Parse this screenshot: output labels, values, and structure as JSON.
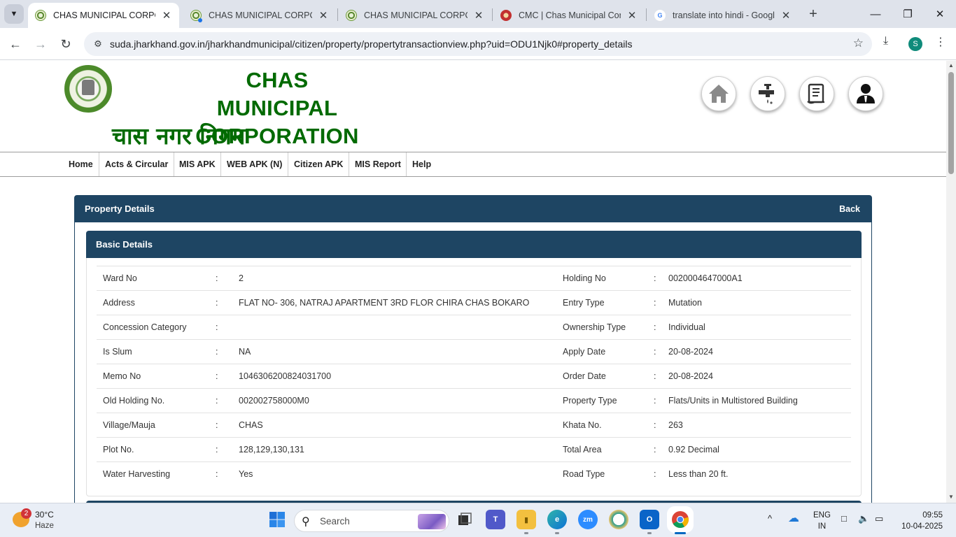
{
  "browser": {
    "tabs": [
      {
        "title": "CHAS MUNICIPAL CORPORA",
        "active": true
      },
      {
        "title": "CHAS MUNICIPAL CORPORA",
        "active": false
      },
      {
        "title": "CHAS MUNICIPAL CORPORA",
        "active": false
      },
      {
        "title": "CMC | Chas Municipal Corpo",
        "active": false
      },
      {
        "title": "translate into hindi - Google",
        "active": false
      }
    ],
    "url_host": "suda.jharkhand.gov.in",
    "url_path": "/jharkhandmunicipal/citizen/property/propertytransactionview.php?uid=ODU1Njk0#property_details",
    "profile_initial": "S"
  },
  "header": {
    "title": "CHAS MUNICIPAL CORPORATION",
    "title_hindi": "चास नगर निगम",
    "icons": [
      "home-icon",
      "water-tap-icon",
      "certificate-icon",
      "user-icon"
    ]
  },
  "nav": {
    "items": [
      "Home",
      "Acts & Circular",
      "MIS APK",
      "WEB APK (N)",
      "Citizen APK",
      "MIS Report",
      "Help"
    ]
  },
  "panel": {
    "title": "Property Details",
    "back_label": "Back",
    "section_title": "Basic Details",
    "rows": [
      {
        "label": "Ward No",
        "value": "2",
        "label2": "Holding No",
        "value2": "0020004647000A1"
      },
      {
        "label": "Address",
        "value": "FLAT NO- 306, NATRAJ APARTMENT 3RD FLOR CHIRA CHAS BOKARO",
        "label2": "Entry Type",
        "value2": "Mutation"
      },
      {
        "label": "Concession Category",
        "value": "",
        "label2": "Ownership Type",
        "value2": "Individual"
      },
      {
        "label": "Is Slum",
        "value": "NA",
        "label2": "Apply Date",
        "value2": "20-08-2024"
      },
      {
        "label": "Memo No",
        "value": "1046306200824031700",
        "label2": "Order Date",
        "value2": "20-08-2024"
      },
      {
        "label": "Old Holding No.",
        "value": "002002758000M0",
        "label2": "Property Type",
        "value2": "Flats/Units in Multistored Building"
      },
      {
        "label": "Village/Mauja",
        "value": "CHAS",
        "label2": "Khata No.",
        "value2": "263"
      },
      {
        "label": "Plot No.",
        "value": "128,129,130,131",
        "label2": "Total Area",
        "value2": "0.92 Decimal"
      },
      {
        "label": "Water Harvesting",
        "value": "Yes",
        "label2": "Road Type",
        "value2": "Less than 20 ft."
      }
    ]
  },
  "taskbar": {
    "weather_temp": "30°C",
    "weather_desc": "Haze",
    "weather_badge": "2",
    "search_placeholder": "Search",
    "lang_top": "ENG",
    "lang_bottom": "IN",
    "time": "09:55",
    "date": "10-04-2025"
  },
  "colors": {
    "header_green": "#006a00",
    "panel_blue": "#1e4563"
  }
}
